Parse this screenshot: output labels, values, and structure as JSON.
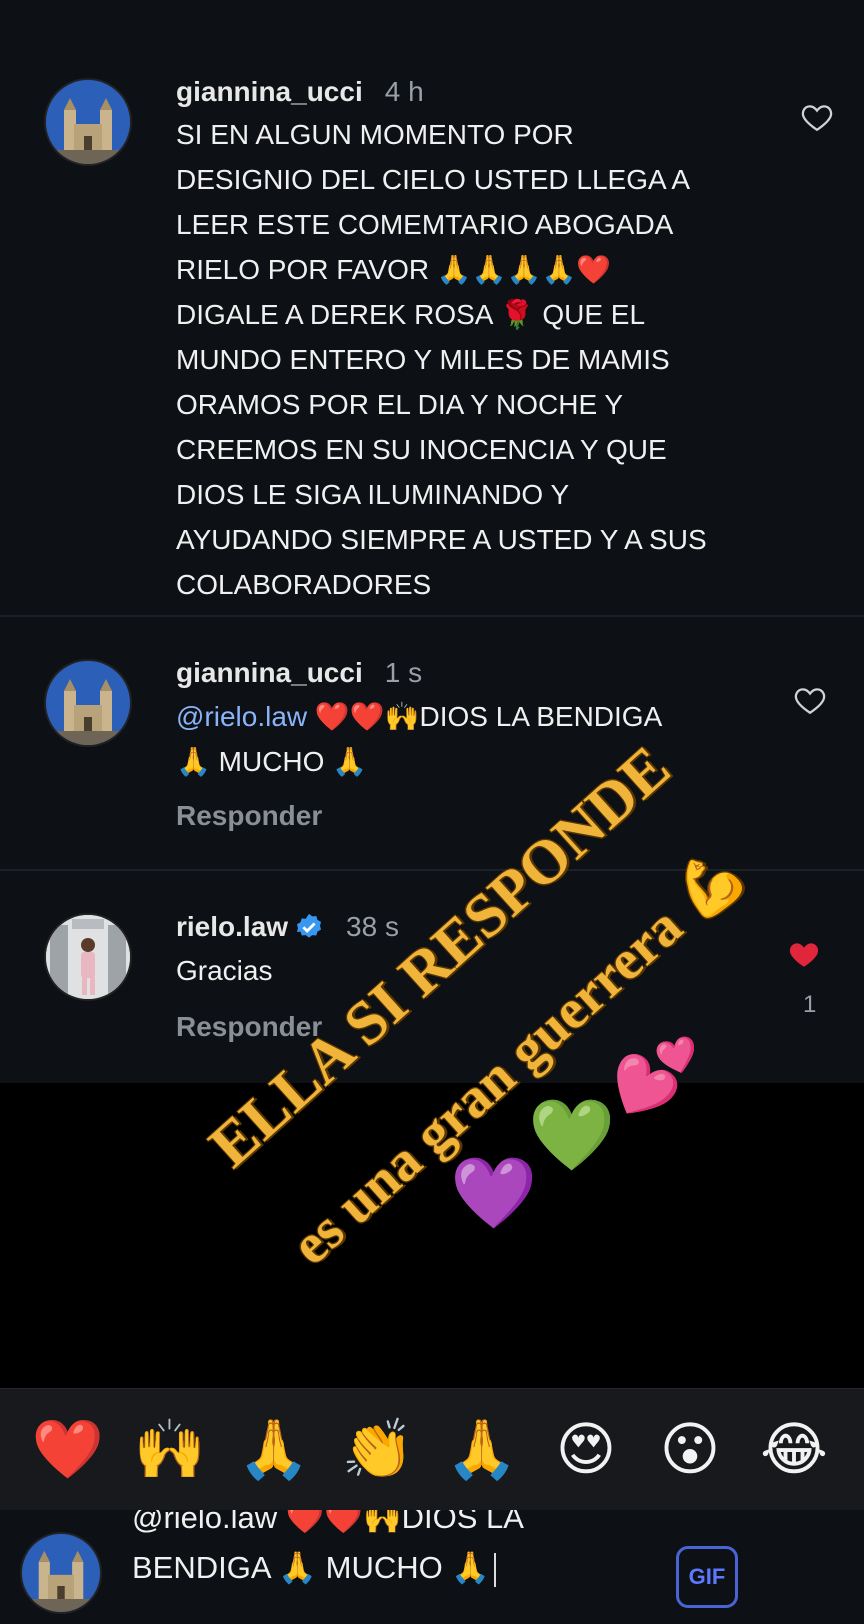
{
  "comments": [
    {
      "username": "giannina_ucci",
      "time": "4 h",
      "text": "SI EN ALGUN MOMENTO POR\nDESIGNIO DEL CIELO  USTED LLEGA A\nLEER ESTE COMEMTARIO ABOGADA\nRIELO POR FAVOR 🙏🙏🙏🙏❤️\nDIGALE A DEREK ROSA 🌹 QUE EL\nMUNDO ENTERO Y MILES DE MAMIS\nORAMOS POR EL DIA Y NOCHE Y\nCREEMOS EN SU INOCENCIA Y QUE\nDIOS LE SIGA ILUMINANDO Y\nAYUDANDO SIEMPRE A USTED Y A SUS\nCOLABORADORES"
    },
    {
      "username": "giannina_ucci",
      "time": "1 s",
      "mention": "@rielo.law",
      "text": " ❤️❤️🙌DIOS LA BENDIGA\n🙏 MUCHO 🙏",
      "reply_label": "Responder"
    },
    {
      "username": "rielo.law",
      "time": "38 s",
      "text": "Gracias",
      "reply_label": "Responder",
      "like_count": "1"
    }
  ],
  "overlay": {
    "line1": "ELLA SI RESPONDE",
    "line2": "es una gran guerrera 💪",
    "emoji_pink": "💕",
    "emoji_green": "💚",
    "emoji_purple": "💜"
  },
  "reactions": [
    "❤️",
    "🙌",
    "🙏",
    "👏",
    "🙏",
    "😍",
    "😮",
    "😂"
  ],
  "input": {
    "line1": "@rielo.law ❤️❤️🙌DIOS LA",
    "line2": "BENDIGA 🙏 MUCHO 🙏",
    "gif_label": "GIF"
  },
  "colors": {
    "background": "#0d1015",
    "accent": "#8ab4f8",
    "like_red": "#e0263b",
    "overlay_gold": "#f0b43a"
  }
}
